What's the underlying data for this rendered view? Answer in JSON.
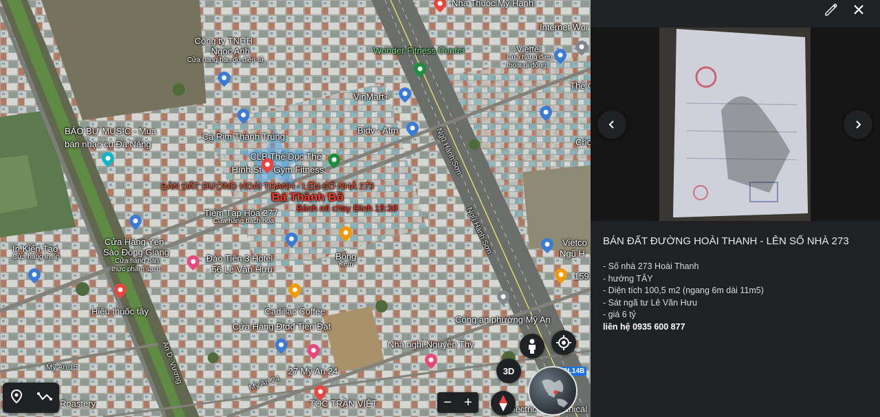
{
  "map": {
    "labels": {
      "nha_thuoc": "Nhà Thuốc Mỹ Hạnh",
      "internet": "Internet Wor",
      "cong_ty": "Công ty TNHH",
      "ngoc_anh": "Ngọc Anh",
      "ngoc_anh_sub": "Cửa hàng bán đồ điện tử",
      "wonder": "Wonder Fitness Center",
      "viettel": "Viettel",
      "viettel_sub1": "Cửa hàng điện",
      "viettel_sub2": "thoại di động",
      "the_edge": "Thế G",
      "vinmart": "VinMart+",
      "bidv": "Bidv - Atm",
      "bao_bu": "BẢO BỰ MUSIC - Mua",
      "bao_bu_2": "bán nhạc cụ Đà Nẵng",
      "ca_rim": "Cá Rim Thành Trung",
      "clb": "CLB Thể Dục Thể",
      "hinh_st": "Hình St",
      "gym": "Gym Fitness",
      "cho": "Chợ",
      "ban_dat": "BÁN ĐẤT ĐƯỜNG HOÀI THANH - LÊN SỐ NHÀ 273",
      "watermark": "Bá Thành Bồ",
      "banh_mi": "Bánh mì chay Đình 15:30",
      "tiem_tap_hoa": "Tiệm Tạp Hóa 277",
      "tiem_sub": "Cửa hàng bách hóa",
      "ngu_hanh_son_1": "Ngũ Hành Sơn",
      "ngu_hanh_son_2": "Ngũ Hành Sơn",
      "in_kien_tao": "In Kiến Tạo",
      "in_sub": "Cửa hàng in ấn",
      "cua_hang_yen": "Cửa Hàng Yến",
      "sao_dong_giang": "Sào Đông Giang",
      "yen_sub1": "Cửa hàng bán",
      "yen_sub2": "thực phẩm sạch",
      "dao_tien": "Đào Tiên 3 Hotel",
      "dao_tien_2": "- 56 Lê Văn Hưu",
      "bong": "Bống",
      "bong_sub": "Kem",
      "vietcom": "Vietco",
      "ngu_h": "Ngũ H",
      "num_159": "159",
      "hieu_thuoc": "Hiệu thuốc tây",
      "cadillac": "Cadillac Coffee",
      "cua_hang_dtdd": "Cửa Hàng Đtdđ Tiến Đạt",
      "cong_an": "Công an phường Mỹ An",
      "nha_nghi": "Nhà nghỉ Nguyễn Thy",
      "an_d_vuong": "An D. Vương",
      "my_an_15": "Mỹ An 15",
      "my_an_24": "Mỹ An 24",
      "num_27": "27 Mỹ An 24",
      "toc_tran_viet": "TỘC TRẦN VIỆT",
      "roastery": "Roastery",
      "electric": "Electric",
      "mechanical": "anical"
    },
    "controls": {
      "btn_3d": "3D",
      "zoom_out": "−",
      "zoom_in": "+",
      "road_shield": "QL14B"
    }
  },
  "panel": {
    "title": "BÁN ĐẤT ĐƯỜNG HOÀI THANH - LÊN SỐ NHÀ 273",
    "description_lines": [
      "- Số nhà 273 Hoài Thanh",
      "- hướng TÂY",
      "- Diện tích 100,5 m2 (ngang 6m dài 11m5)",
      "- Sát ngã tư Lê Văn Hưu",
      "- giá 6 tỷ"
    ],
    "contact": "liên hệ 0935 600 877"
  },
  "icons": {
    "edit": "pencil-icon",
    "close": "close-icon",
    "prev": "chevron-left-icon",
    "next": "chevron-right-icon",
    "pegman": "pegman-icon",
    "locate": "my-location-icon",
    "compass": "compass-icon",
    "pin": "location-pin-icon",
    "measure": "measure-distance-icon"
  },
  "colors": {
    "panel_bg": "#202124",
    "ad_red": "#ff3b2f",
    "pin_blue": "#3a7bd5",
    "pin_red": "#e8453c",
    "pin_green": "#1e8e3e",
    "pin_orange": "#f29900",
    "pin_pink": "#e7497d"
  }
}
